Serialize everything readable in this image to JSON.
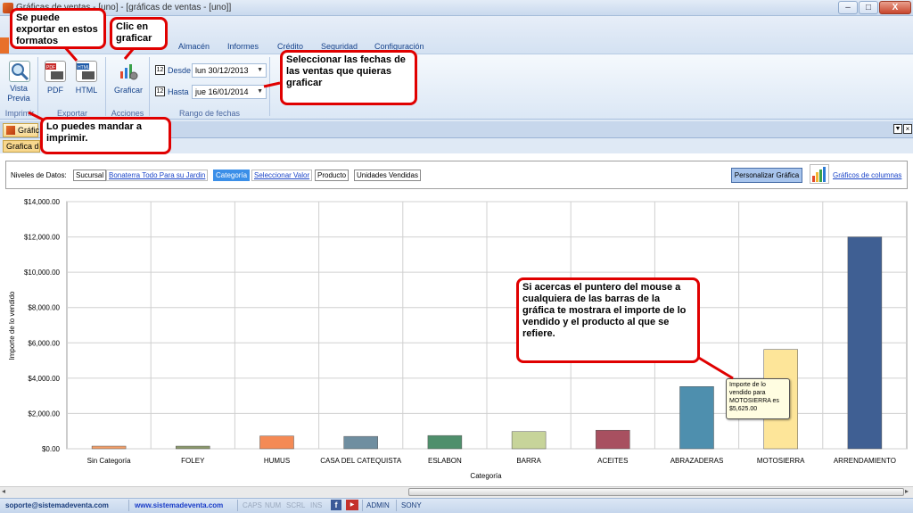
{
  "window": {
    "title": "Gráficas de ventas - [uno] - [gráficas de ventas - [uno]]",
    "min": "–",
    "max": "□",
    "close": "X"
  },
  "menu": [
    "Almacén",
    "Informes",
    "Crédito",
    "Seguridad",
    "Configuración"
  ],
  "ribbon": {
    "vista_previa": "Vista Previa",
    "pdf": "PDF",
    "html": "HTML",
    "graficar": "Graficar",
    "desde_label": "Desde",
    "desde_value": "lun 30/12/2013",
    "hasta_label": "Hasta",
    "hasta_value": "jue 16/01/2014",
    "group_imprimir": "Imprimir",
    "group_exportar": "Exportar",
    "group_acciones": "Acciones",
    "group_rango": "Rango de fechas"
  },
  "doc_tab": "Gráfic",
  "sub_tab": "Grafica de",
  "filters": {
    "label": "Niveles de Datos:",
    "sucursal": "Sucursal",
    "sucursal_value": "Bonaterra Todo Para su Jardin",
    "categoria": "Categoría",
    "seleccionar": "Seleccionar Valor",
    "producto": "Producto",
    "unidades": "Unidades Vendidas",
    "personalizar": "Personalizar Gráfica",
    "graficos_columnas": "Gráficos de columnas"
  },
  "chart_data": {
    "type": "bar",
    "categories": [
      "Sin Categoría",
      "FOLEY",
      "HUMUS",
      "CASA DEL CATEQUISTA",
      "ESLABON",
      "BARRA",
      "ACEITES",
      "ABRAZADERAS",
      "MOTOSIERRA",
      "ARRENDAMIENTO"
    ],
    "values": [
      150,
      150,
      725,
      700,
      750,
      975,
      1050,
      3525,
      5625,
      12000
    ],
    "colors": [
      "#f4a06a",
      "#8c9a6c",
      "#f48a55",
      "#6f8ea0",
      "#4f8f6c",
      "#c7d49a",
      "#a85060",
      "#4e8fae",
      "#fde599",
      "#3f5f93"
    ],
    "ylabel": "Importe de lo vendido",
    "xlabel": "Categoría",
    "ylim": [
      0,
      14000
    ],
    "yticks": [
      "$0.00",
      "$2,000.00",
      "$4,000.00",
      "$6,000.00",
      "$8,000.00",
      "$10,000.00",
      "$12,000.00",
      "$14,000.00"
    ],
    "grid": true
  },
  "tooltip": "Importe de lo vendido para MOTOSIERRA es $5,625.00",
  "callouts": {
    "exportar": "Se puede exportar en estos formatos",
    "graficar": "Clic en graficar",
    "fechas": "Seleccionar las fechas de las ventas que quieras graficar",
    "imprimir": "Lo puedes mandar a imprimir.",
    "puntero": "Si acercas el puntero del mouse a cualquiera de las barras de la gráfica te mostrara el importe de lo vendido y el producto al que se refiere."
  },
  "status": {
    "email": "soporte@sistemadeventa.com",
    "web": "www.sistemadeventa.com",
    "caps": "CAPS",
    "num": "NUM",
    "scrl": "SCRL",
    "ins": "INS",
    "user": "ADMIN",
    "machine": "SONY"
  }
}
